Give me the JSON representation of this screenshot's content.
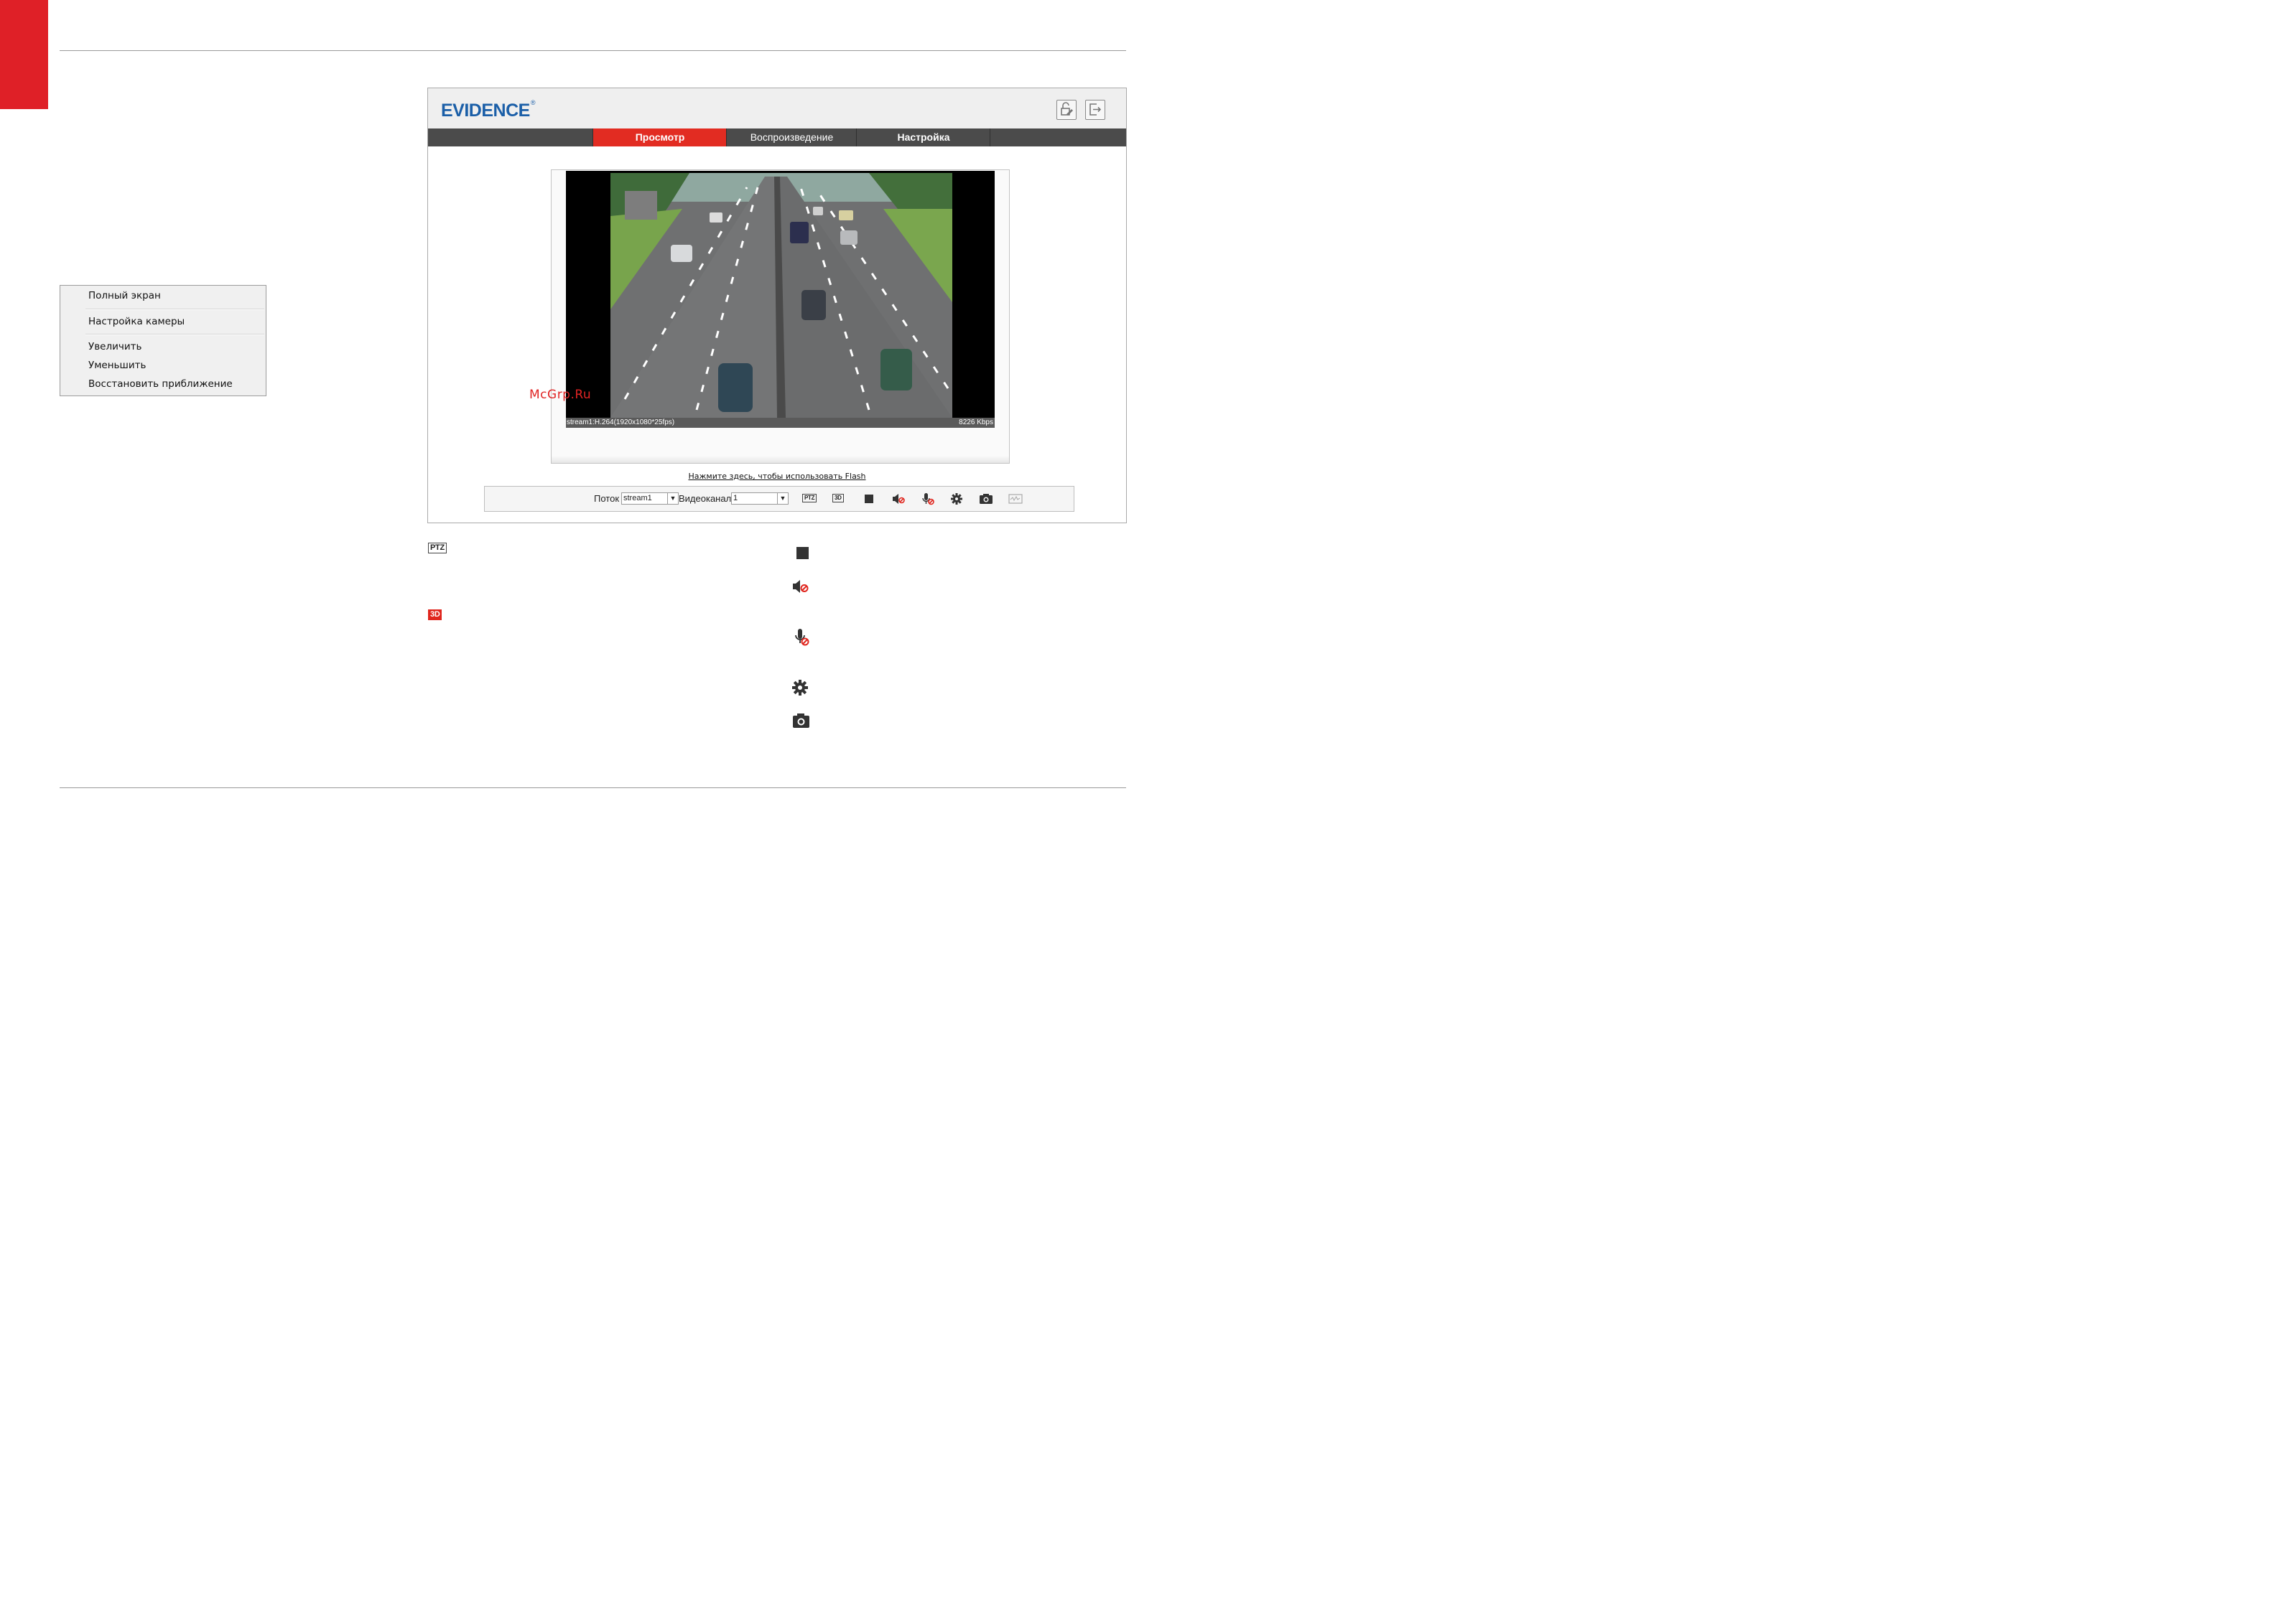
{
  "context_menu": {
    "items": [
      "Полный экран",
      "Настройка камеры",
      "Увеличить",
      "Уменьшить",
      "Восстановить приближение"
    ]
  },
  "webui": {
    "logo": "EVIDENCE",
    "logo_mark": "®",
    "nav": [
      "Просмотр",
      "Воспроизведение",
      "Настройка"
    ],
    "active_tab": "Просмотр",
    "status_left": "stream1:H.264(1920x1080*25fps)",
    "status_right": "8226 Kbps",
    "flash_link": "Нажмите здесь, чтобы использовать Flash",
    "toolbar": {
      "stream_label": "Поток",
      "stream_value": "stream1",
      "channel_label": "Видеоканал",
      "channel_value": "1",
      "ptz": "PTZ",
      "three_d": "3D"
    }
  },
  "legend": {
    "ptz": "PTZ",
    "three_d": "3D"
  },
  "watermark": "McGrp.Ru",
  "colors": {
    "accent_red": "#df2027",
    "logo_blue": "#1b5fa8",
    "nav_bg": "#4b4b4b"
  }
}
